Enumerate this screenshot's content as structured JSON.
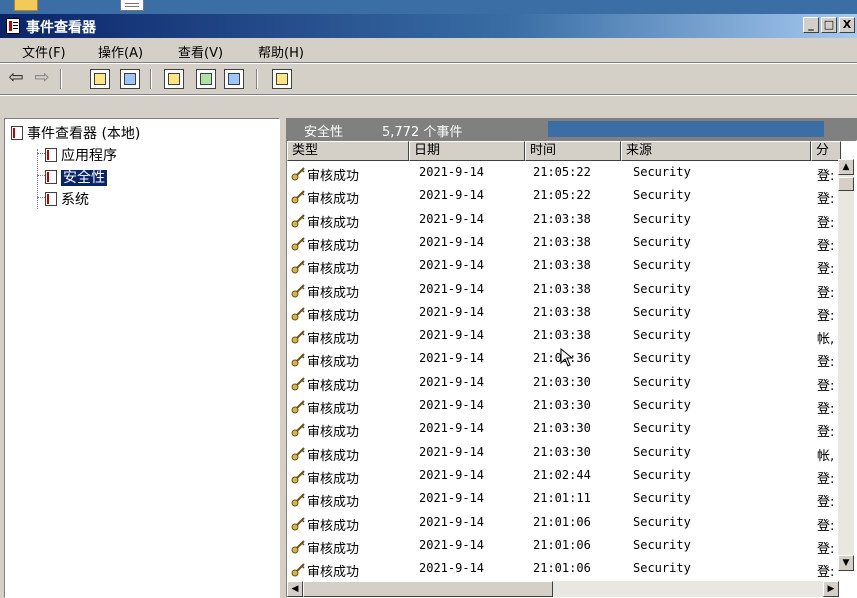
{
  "window": {
    "title": "事件查看器",
    "buttons": {
      "minimize": "_",
      "maximize": "□",
      "close": "X"
    }
  },
  "menu": [
    {
      "label": "文件(F)"
    },
    {
      "label": "操作(A)"
    },
    {
      "label": "查看(V)"
    },
    {
      "label": "帮助(H)"
    }
  ],
  "toolbar": {
    "icons": [
      "back-arrow-icon",
      "forward-arrow-icon",
      "up-folder-icon",
      "show-hide-tree-icon",
      "properties-icon",
      "refresh-icon",
      "export-list-icon",
      "help-icon"
    ]
  },
  "tree": {
    "root": "事件查看器 (本地)",
    "items": [
      {
        "label": "应用程序"
      },
      {
        "label": "安全性"
      },
      {
        "label": "系统"
      }
    ]
  },
  "list": {
    "header_title": "安全性",
    "header_count": "5,772 个事件",
    "columns": [
      {
        "label": "类型"
      },
      {
        "label": "日期"
      },
      {
        "label": "时间"
      },
      {
        "label": "来源"
      },
      {
        "label": "分"
      }
    ],
    "rows": [
      {
        "type": "审核成功",
        "date": "2021-9-14",
        "time": "21:05:22",
        "source": "Security",
        "cat": "登:"
      },
      {
        "type": "审核成功",
        "date": "2021-9-14",
        "time": "21:05:22",
        "source": "Security",
        "cat": "登:"
      },
      {
        "type": "审核成功",
        "date": "2021-9-14",
        "time": "21:03:38",
        "source": "Security",
        "cat": "登:"
      },
      {
        "type": "审核成功",
        "date": "2021-9-14",
        "time": "21:03:38",
        "source": "Security",
        "cat": "登:"
      },
      {
        "type": "审核成功",
        "date": "2021-9-14",
        "time": "21:03:38",
        "source": "Security",
        "cat": "登:"
      },
      {
        "type": "审核成功",
        "date": "2021-9-14",
        "time": "21:03:38",
        "source": "Security",
        "cat": "登:"
      },
      {
        "type": "审核成功",
        "date": "2021-9-14",
        "time": "21:03:38",
        "source": "Security",
        "cat": "登:"
      },
      {
        "type": "审核成功",
        "date": "2021-9-14",
        "time": "21:03:38",
        "source": "Security",
        "cat": "帐,"
      },
      {
        "type": "审核成功",
        "date": "2021-9-14",
        "time": "21:03:36",
        "source": "Security",
        "cat": "登:"
      },
      {
        "type": "审核成功",
        "date": "2021-9-14",
        "time": "21:03:30",
        "source": "Security",
        "cat": "登:"
      },
      {
        "type": "审核成功",
        "date": "2021-9-14",
        "time": "21:03:30",
        "source": "Security",
        "cat": "登:"
      },
      {
        "type": "审核成功",
        "date": "2021-9-14",
        "time": "21:03:30",
        "source": "Security",
        "cat": "登:"
      },
      {
        "type": "审核成功",
        "date": "2021-9-14",
        "time": "21:03:30",
        "source": "Security",
        "cat": "帐,"
      },
      {
        "type": "审核成功",
        "date": "2021-9-14",
        "time": "21:02:44",
        "source": "Security",
        "cat": "登:"
      },
      {
        "type": "审核成功",
        "date": "2021-9-14",
        "time": "21:01:11",
        "source": "Security",
        "cat": "登:"
      },
      {
        "type": "审核成功",
        "date": "2021-9-14",
        "time": "21:01:06",
        "source": "Security",
        "cat": "登:"
      },
      {
        "type": "审核成功",
        "date": "2021-9-14",
        "time": "21:01:06",
        "source": "Security",
        "cat": "登:"
      },
      {
        "type": "审核成功",
        "date": "2021-9-14",
        "time": "21:01:06",
        "source": "Security",
        "cat": "登:"
      }
    ]
  },
  "colors": {
    "titlebar_start": "#0a246a",
    "titlebar_end": "#a6caf0",
    "selection": "#0a246a",
    "face": "#d4d0c8",
    "header_band": "#808080"
  }
}
